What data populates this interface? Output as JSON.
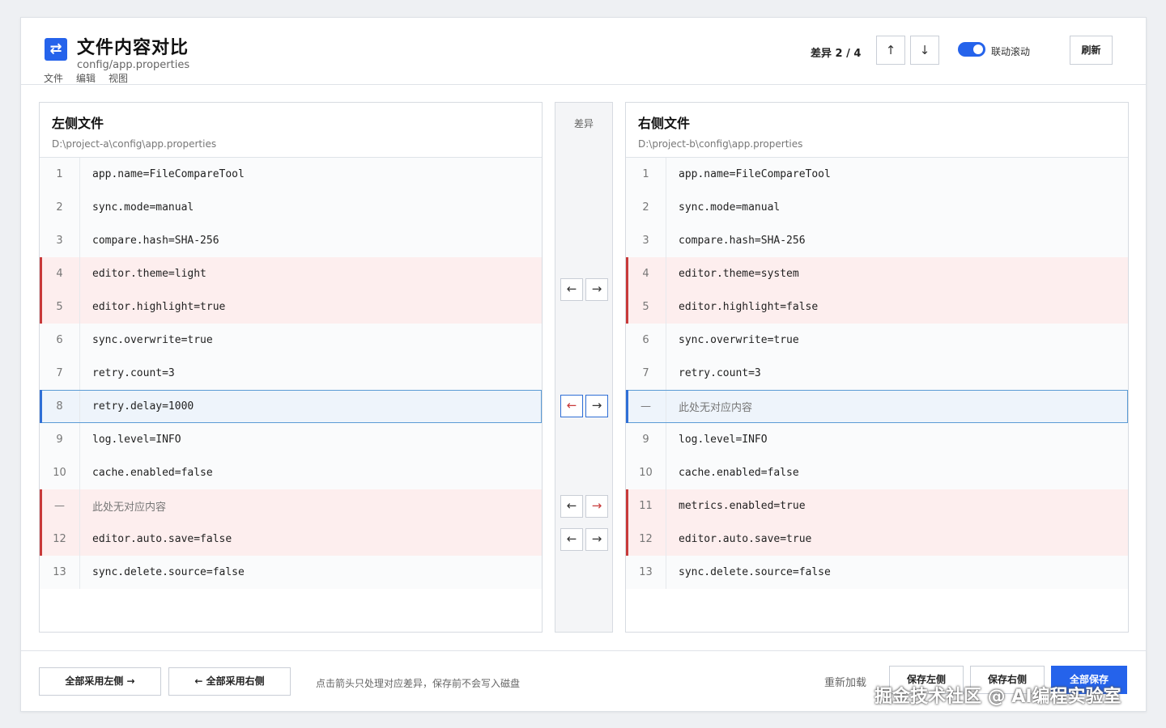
{
  "header": {
    "title": "文件内容对比",
    "subtitle": "config/app.properties",
    "menu": [
      "文件",
      "编辑",
      "视图"
    ],
    "diff_counter": "差异 2 / 4",
    "prev_label": "↑",
    "next_label": "↓",
    "sync_scroll_label": "联动滚动",
    "sync_scroll_on": true,
    "refresh_label": "刷新"
  },
  "left": {
    "title": "左侧文件",
    "path": "D:\\project-a\\config\\app.properties",
    "lines": [
      {
        "num": "1",
        "text": "app.name=FileCompareTool",
        "state": "same"
      },
      {
        "num": "2",
        "text": "sync.mode=manual",
        "state": "same"
      },
      {
        "num": "3",
        "text": "compare.hash=SHA-256",
        "state": "same"
      },
      {
        "num": "4",
        "text": "editor.theme=light",
        "state": "changed"
      },
      {
        "num": "5",
        "text": "editor.highlight=true",
        "state": "changed"
      },
      {
        "num": "6",
        "text": "sync.overwrite=true",
        "state": "same"
      },
      {
        "num": "7",
        "text": "retry.count=3",
        "state": "same"
      },
      {
        "num": "8",
        "text": "retry.delay=1000",
        "state": "current"
      },
      {
        "num": "9",
        "text": "log.level=INFO",
        "state": "same"
      },
      {
        "num": "10",
        "text": "cache.enabled=false",
        "state": "same"
      },
      {
        "num": "—",
        "text": "此处无对应内容",
        "state": "changed-empty"
      },
      {
        "num": "12",
        "text": "editor.auto.save=false",
        "state": "changed"
      },
      {
        "num": "13",
        "text": "sync.delete.source=false",
        "state": "same"
      }
    ]
  },
  "right": {
    "title": "右侧文件",
    "path": "D:\\project-b\\config\\app.properties",
    "lines": [
      {
        "num": "1",
        "text": "app.name=FileCompareTool",
        "state": "same"
      },
      {
        "num": "2",
        "text": "sync.mode=manual",
        "state": "same"
      },
      {
        "num": "3",
        "text": "compare.hash=SHA-256",
        "state": "same"
      },
      {
        "num": "4",
        "text": "editor.theme=system",
        "state": "changed"
      },
      {
        "num": "5",
        "text": "editor.highlight=false",
        "state": "changed"
      },
      {
        "num": "6",
        "text": "sync.overwrite=true",
        "state": "same"
      },
      {
        "num": "7",
        "text": "retry.count=3",
        "state": "same"
      },
      {
        "num": "—",
        "text": "此处无对应内容",
        "state": "current-empty"
      },
      {
        "num": "9",
        "text": "log.level=INFO",
        "state": "same"
      },
      {
        "num": "10",
        "text": "cache.enabled=false",
        "state": "same"
      },
      {
        "num": "11",
        "text": "metrics.enabled=true",
        "state": "changed"
      },
      {
        "num": "12",
        "text": "editor.auto.save=true",
        "state": "changed"
      },
      {
        "num": "13",
        "text": "sync.delete.source=false",
        "state": "same"
      }
    ]
  },
  "middle": {
    "title": "差异",
    "left_arrow": "←",
    "right_arrow": "→"
  },
  "footer": {
    "accept_all_left": "全部采用左侧 →",
    "accept_all_right": "← 全部采用右侧",
    "hint": "点击箭头只处理对应差异，保存前不会写入磁盘",
    "reload": "重新加载",
    "save_left": "保存左侧",
    "save_right": "保存右侧",
    "save_all": "全部保存"
  },
  "watermark": "掘金技术社区 @ AI编程实验室",
  "colors": {
    "accent": "#2563eb",
    "changed_bg": "#fdeeee",
    "changed_bar": "#c83a3a",
    "current_border": "#5b9bd5"
  }
}
